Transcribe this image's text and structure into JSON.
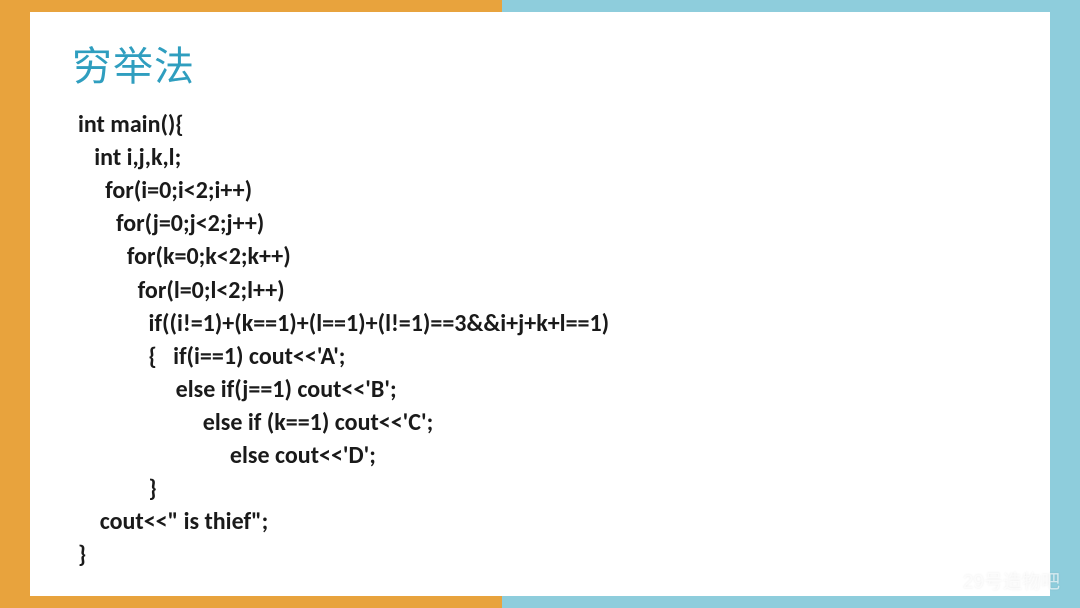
{
  "title": "穷举法",
  "code_lines": [
    "int main(){",
    "   int i,j,k,l;",
    "     for(i=0;i<2;i++)",
    "       for(j=0;j<2;j++)",
    "         for(k=0;k<2;k++)",
    "           for(l=0;l<2;l++)",
    "             if((i!=1)+(k==1)+(l==1)+(l!=1)==3&&i+j+k+l==1)",
    "             {   if(i==1) cout<<'A';",
    "                  else if(j==1) cout<<'B';",
    "                       else if (k==1) cout<<'C';",
    "                            else cout<<'D';",
    "             }",
    "    cout<<\" is thief\";",
    "}"
  ],
  "watermark": {
    "text": "29号造物吧"
  }
}
